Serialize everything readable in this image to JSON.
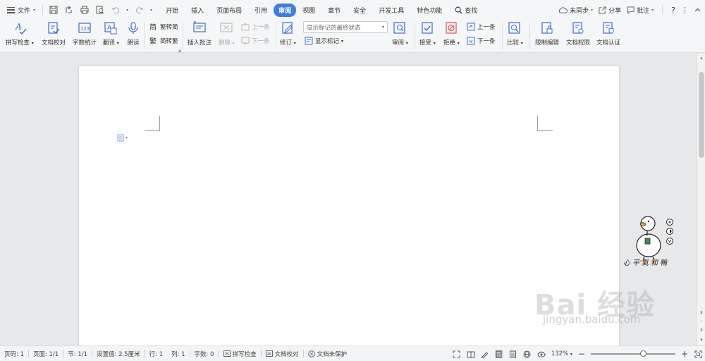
{
  "menubar": {
    "file_label": "文件",
    "tabs": [
      "开始",
      "插入",
      "页面布局",
      "引用",
      "审阅",
      "视图",
      "章节",
      "安全",
      "开发工具",
      "特色功能"
    ],
    "active_tab": "审阅",
    "search_label": "查找",
    "right": {
      "sync": "未同步",
      "share": "分享",
      "comment": "批注",
      "help": "?",
      "more": "⋮"
    }
  },
  "ribbon": {
    "spell_check": "拼写检查",
    "doc_proofread": "文档校对",
    "word_count": "字数统计",
    "translate": "翻译",
    "read_aloud": "朗读",
    "trad_to_simp": "繁转简",
    "simp_to_trad": "简转繁",
    "insert_comment": "插入批注",
    "delete": "删除",
    "prev_comment": "上一条",
    "next_comment": "下一条",
    "track_changes": "修订",
    "show_markup_state": "显示标记的最终状态",
    "show_markup": "显示标记",
    "review": "审阅",
    "accept": "接受",
    "reject": "拒绝",
    "prev_change": "上一条",
    "next_change": "下一条",
    "compare": "比较",
    "restrict_edit": "限制编辑",
    "doc_permission": "文档权限",
    "doc_certify": "文档认证"
  },
  "watermark": {
    "duck_caption": "心平氣和鴨",
    "baidu_logo": "Bai 经验",
    "baidu_url": "jingyan.baidu.com"
  },
  "statusbar": {
    "page_num": "页码: 1",
    "pages": "页面: 1/1",
    "section": "节: 1/1",
    "position": "设置值: 2.5厘米",
    "line": "行: 1",
    "column": "列: 1",
    "word_count": "字数: 0",
    "spell_check": "拼写检查",
    "proofread": "文档校对",
    "protect": "文档未保护",
    "zoom": "132%",
    "zoom_fraction": 0.62
  },
  "colors": {
    "accent": "#3f7ede"
  }
}
